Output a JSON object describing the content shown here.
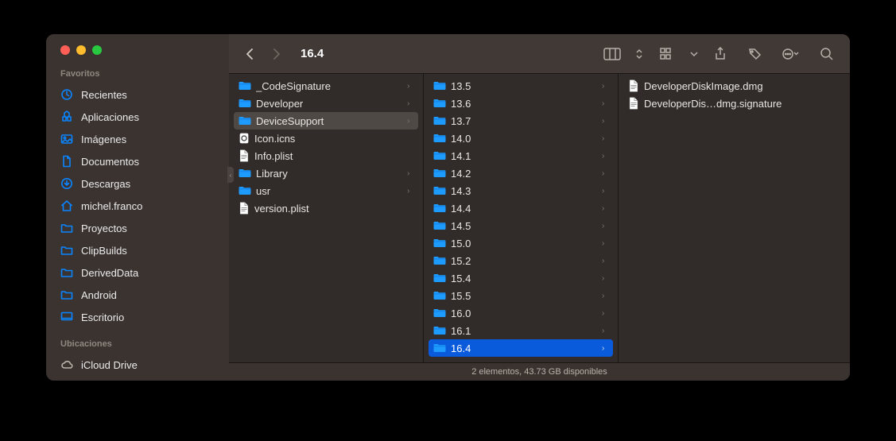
{
  "window": {
    "title": "16.4"
  },
  "sidebar": {
    "sections": [
      {
        "label": "Favoritos",
        "items": [
          {
            "icon": "clock",
            "label": "Recientes"
          },
          {
            "icon": "apps",
            "label": "Aplicaciones"
          },
          {
            "icon": "images",
            "label": "Imágenes"
          },
          {
            "icon": "doc",
            "label": "Documentos"
          },
          {
            "icon": "download",
            "label": "Descargas"
          },
          {
            "icon": "home",
            "label": "michel.franco"
          },
          {
            "icon": "folder",
            "label": "Proyectos"
          },
          {
            "icon": "folder",
            "label": "ClipBuilds"
          },
          {
            "icon": "folder",
            "label": "DerivedData"
          },
          {
            "icon": "folder",
            "label": "Android"
          },
          {
            "icon": "desktop",
            "label": "Escritorio"
          }
        ]
      },
      {
        "label": "Ubicaciones",
        "items": [
          {
            "icon": "cloud",
            "label": "iCloud Drive"
          }
        ]
      }
    ]
  },
  "columns": [
    {
      "items": [
        {
          "type": "folder",
          "label": "_CodeSignature",
          "chevron": true,
          "sel": null
        },
        {
          "type": "folder",
          "label": "Developer",
          "chevron": true,
          "sel": null
        },
        {
          "type": "folder",
          "label": "DeviceSupport",
          "chevron": true,
          "sel": "gray"
        },
        {
          "type": "icns",
          "label": "Icon.icns",
          "chevron": false,
          "sel": null
        },
        {
          "type": "file",
          "label": "Info.plist",
          "chevron": false,
          "sel": null
        },
        {
          "type": "folder",
          "label": "Library",
          "chevron": true,
          "sel": null
        },
        {
          "type": "folder",
          "label": "usr",
          "chevron": true,
          "sel": null
        },
        {
          "type": "file",
          "label": "version.plist",
          "chevron": false,
          "sel": null
        }
      ]
    },
    {
      "items": [
        {
          "type": "folder",
          "label": "13.5",
          "chevron": true,
          "sel": null
        },
        {
          "type": "folder",
          "label": "13.6",
          "chevron": true,
          "sel": null
        },
        {
          "type": "folder",
          "label": "13.7",
          "chevron": true,
          "sel": null
        },
        {
          "type": "folder",
          "label": "14.0",
          "chevron": true,
          "sel": null
        },
        {
          "type": "folder",
          "label": "14.1",
          "chevron": true,
          "sel": null
        },
        {
          "type": "folder",
          "label": "14.2",
          "chevron": true,
          "sel": null
        },
        {
          "type": "folder",
          "label": "14.3",
          "chevron": true,
          "sel": null
        },
        {
          "type": "folder",
          "label": "14.4",
          "chevron": true,
          "sel": null
        },
        {
          "type": "folder",
          "label": "14.5",
          "chevron": true,
          "sel": null
        },
        {
          "type": "folder",
          "label": "15.0",
          "chevron": true,
          "sel": null
        },
        {
          "type": "folder",
          "label": "15.2",
          "chevron": true,
          "sel": null
        },
        {
          "type": "folder",
          "label": "15.4",
          "chevron": true,
          "sel": null
        },
        {
          "type": "folder",
          "label": "15.5",
          "chevron": true,
          "sel": null
        },
        {
          "type": "folder",
          "label": "16.0",
          "chevron": true,
          "sel": null
        },
        {
          "type": "folder",
          "label": "16.1",
          "chevron": true,
          "sel": null
        },
        {
          "type": "folder",
          "label": "16.4",
          "chevron": true,
          "sel": "blue"
        }
      ]
    },
    {
      "items": [
        {
          "type": "file",
          "label": "DeveloperDiskImage.dmg",
          "chevron": false,
          "sel": null
        },
        {
          "type": "file",
          "label": "DeveloperDis…dmg.signature",
          "chevron": false,
          "sel": null
        }
      ]
    }
  ],
  "status_bar": "2 elementos, 43.73 GB disponibles"
}
